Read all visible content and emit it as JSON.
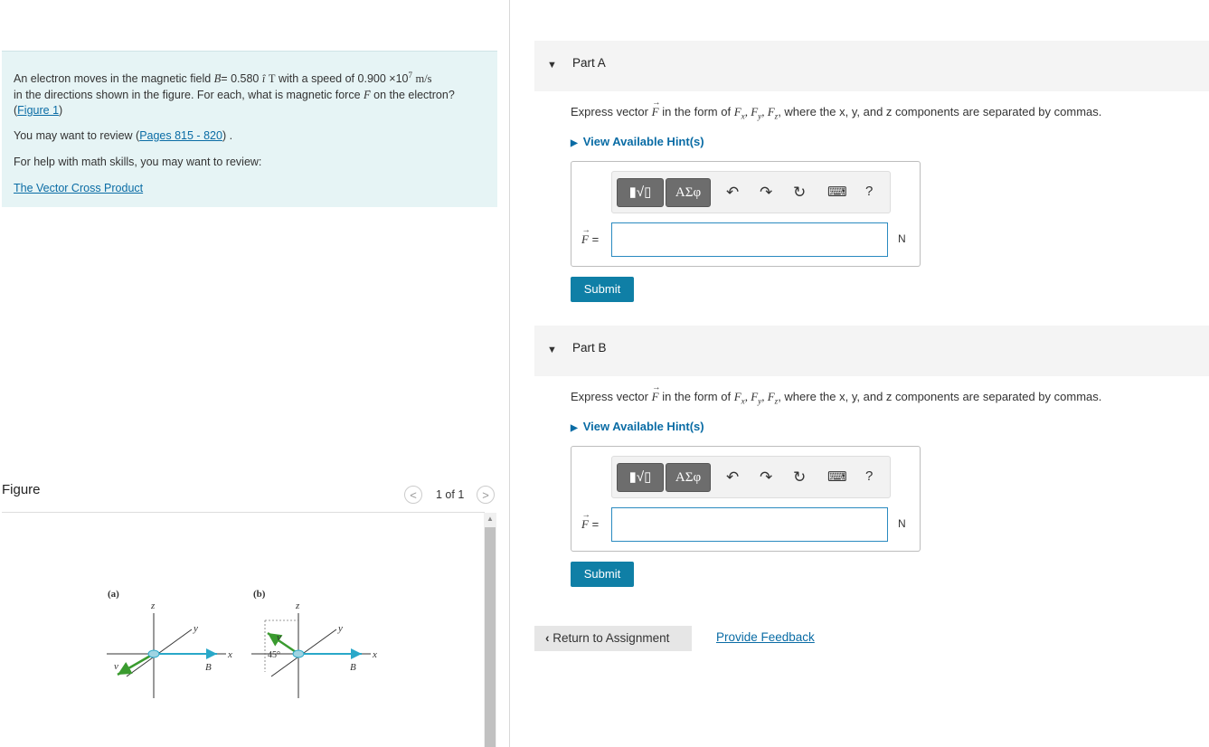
{
  "problem": {
    "intro_1": "An electron moves in the magnetic field",
    "field_symbol": "B",
    "field_value": "= 0.580",
    "unit_vector": "î",
    "field_unit": "T",
    "speed_text": "with a speed of",
    "speed_value": "0.900 ×10",
    "speed_exp": "7",
    "speed_unit": "m/s",
    "intro_2": "in the directions shown in the figure. For each, what is magnetic force",
    "force_symbol": "F",
    "intro_3": "on the electron?",
    "figure_link": "Figure 1",
    "review_prefix": "You may want to review (",
    "review_link": "Pages 815 - 820",
    "review_suffix": ") .",
    "math_help": "For help with math skills, you may want to review:",
    "math_link": "The Vector Cross Product"
  },
  "figure": {
    "header": "Figure",
    "count": "1 of 1",
    "prev_glyph": "<",
    "next_glyph": ">",
    "panel_a_label": "(a)",
    "panel_b_label": "(b)",
    "axis_x": "x",
    "axis_y": "y",
    "axis_z": "z",
    "angle_label": "45°",
    "v_label": "v",
    "b_label": "B"
  },
  "parts": [
    {
      "title": "Part A",
      "prompt_pre": "Express vector",
      "prompt_vec": "F",
      "prompt_mid": "in the form of",
      "prompt_post": "where the x, y, and z components are separated by commas.",
      "hint": "View Available Hint(s)",
      "eq_label": "=",
      "unit": "N",
      "submit": "Submit"
    },
    {
      "title": "Part B",
      "prompt_pre": "Express vector",
      "prompt_vec": "F",
      "prompt_mid": "in the form of",
      "prompt_post": "where the x, y, and z components are separated by commas.",
      "hint": "View Available Hint(s)",
      "eq_label": "=",
      "unit": "N",
      "submit": "Submit"
    }
  ],
  "toolbar": {
    "templates_label": "▮√▯",
    "symbols_label": "ΑΣφ",
    "undo": "↶",
    "redo": "↷",
    "reset": "↻",
    "keyboard": "⌨",
    "help": "?"
  },
  "footer": {
    "return_label": "Return to Assignment",
    "feedback_label": "Provide Feedback"
  },
  "colors": {
    "problem_bg": "#e6f4f5",
    "accent": "#0f7fa6",
    "link": "#0a6ca5",
    "b_arrow": "#29a8c9",
    "v_arrow": "#3a9b2f"
  }
}
